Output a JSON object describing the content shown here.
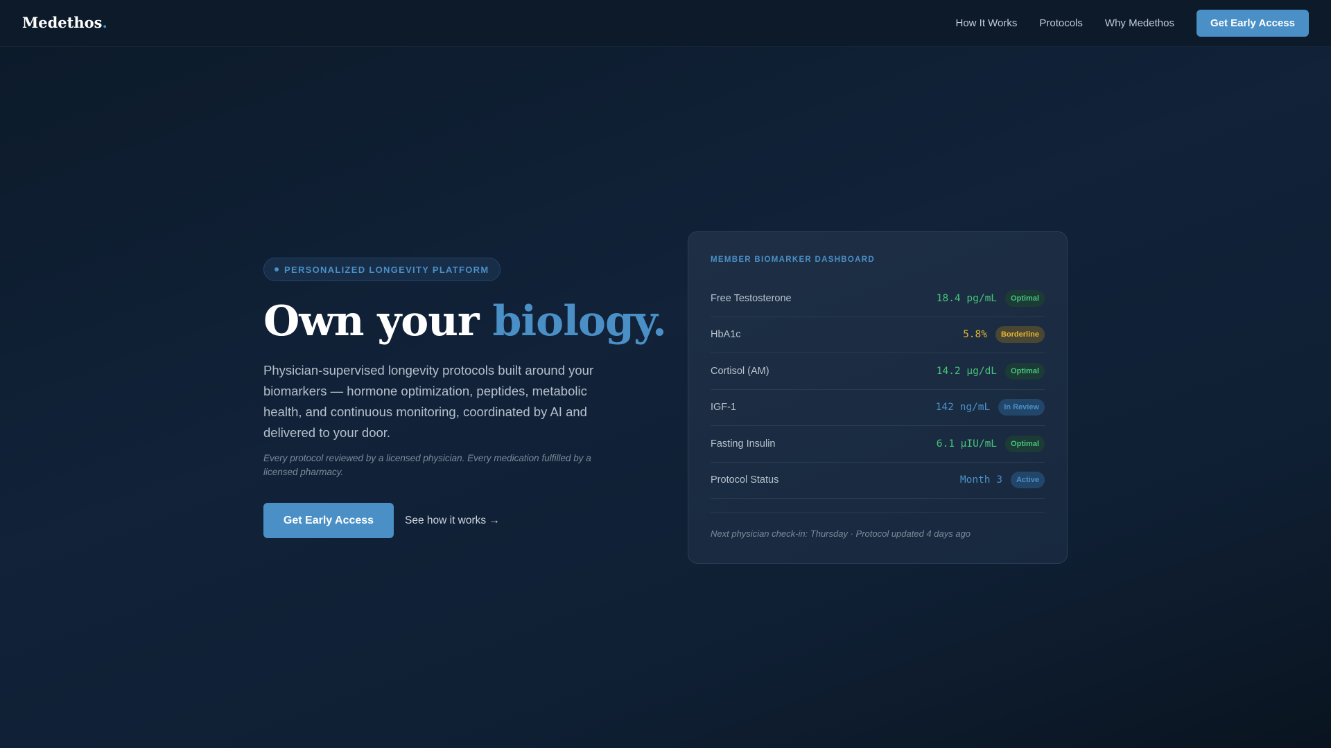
{
  "nav": {
    "logo": "Medethos",
    "logo_dot": ".",
    "links": [
      "How It Works",
      "Protocols",
      "Why Medethos"
    ],
    "cta": "Get Early Access"
  },
  "hero": {
    "badge": "PERSONALIZED LONGEVITY PLATFORM",
    "title_plain": "Own your ",
    "title_accent": "biology.",
    "description": "Physician-supervised longevity protocols built around your biomarkers — hormone optimization, peptides, metabolic health, and continuous monitoring, coordinated by AI and delivered to your door.",
    "note": "Every protocol reviewed by a licensed physician. Every medication fulfilled by a licensed pharmacy.",
    "cta_primary": "Get Early Access",
    "cta_secondary": "See how it works →"
  },
  "dashboard": {
    "title": "MEMBER BIOMARKER DASHBOARD",
    "rows": [
      {
        "label": "Free Testosterone",
        "value": "18.4 pg/mL",
        "status": "Optimal"
      },
      {
        "label": "HbA1c",
        "value": "5.8%",
        "status": "Borderline"
      },
      {
        "label": "Cortisol (AM)",
        "value": "14.2 µg/dL",
        "status": "Optimal"
      },
      {
        "label": "IGF-1",
        "value": "142 ng/mL",
        "status": "In Review"
      },
      {
        "label": "Fasting Insulin",
        "value": "6.1 µIU/mL",
        "status": "Optimal"
      },
      {
        "label": "Protocol Status",
        "value": "Month 3",
        "status": "Active"
      }
    ],
    "footer": "Next physician check-in: Thursday · Protocol updated 4 days ago"
  },
  "colors": {
    "accent": "#4a90c7",
    "optimal": "#45c47a",
    "borderline": "#e3b534"
  }
}
